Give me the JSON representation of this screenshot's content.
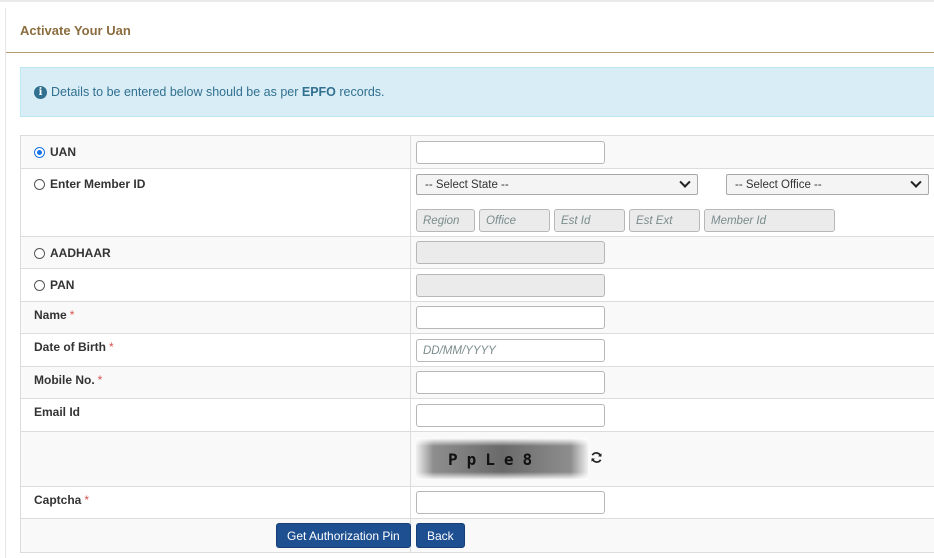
{
  "panel": {
    "title": "Activate Your Uan"
  },
  "alert": {
    "icon": "info-circle-icon",
    "text_before": "Details to be entered below should be as per ",
    "text_bold": "EPFO",
    "text_after": " records."
  },
  "form": {
    "uan": {
      "label": "UAN",
      "selected": true,
      "value": ""
    },
    "member": {
      "label": "Enter Member ID",
      "state_select": "-- Select State --",
      "office_select": "-- Select Office --",
      "region_placeholder": "Region",
      "office_placeholder": "Office",
      "estid_placeholder": "Est Id",
      "estext_placeholder": "Est Ext",
      "memberid_placeholder": "Member Id"
    },
    "aadhaar": {
      "label": "AADHAAR"
    },
    "pan": {
      "label": "PAN"
    },
    "name": {
      "label": "Name",
      "required": "*"
    },
    "dob": {
      "label": "Date of Birth",
      "required": "*",
      "placeholder": "DD/MM/YYYY"
    },
    "mobile": {
      "label": "Mobile No.",
      "required": "*"
    },
    "email": {
      "label": "Email Id"
    },
    "captcha_image_text": "PpLe8",
    "captcha": {
      "label": "Captcha",
      "required": "*"
    }
  },
  "buttons": {
    "get_pin": "Get Authorization Pin",
    "back": "Back"
  }
}
